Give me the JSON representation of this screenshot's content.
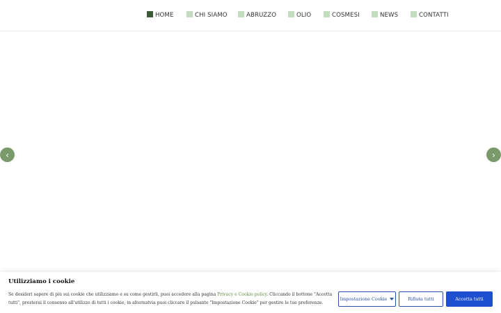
{
  "nav": {
    "items": [
      {
        "label": "HOME"
      },
      {
        "label": "CHI SIAMO"
      },
      {
        "label": "ABRUZZO"
      },
      {
        "label": "OLIO"
      },
      {
        "label": "COSMESI"
      },
      {
        "label": "NEWS"
      },
      {
        "label": "CONTATTI"
      }
    ],
    "active_item": "HOME"
  },
  "slider": {
    "prev_label": "‹",
    "next_label": "›"
  },
  "cookie": {
    "title": "Utilizziamo i cookie",
    "text_before_link": "Se desideri sapere di più sui cookie che utilizziamo e su come gestirli, puoi accedere alla pagina ",
    "link_text": "Privacy e Cookie policy",
    "text_after_link": ". Cliccando il bottone \"Accetta tutti\", presterai il consenso all'utilizzo di tutti i cookie, in alternatvia puoi cliccare il pulsante \"Impostazione Cookie\" per gestire le tue preferenze.",
    "settings_button": "Impostazione Cookie",
    "reject_button": "Rifiuta tutti",
    "accept_button": "Accetta tutti"
  },
  "colors": {
    "nav_square": "#c3dcc0",
    "nav_square_active": "#3c5a35",
    "arrow_bg": "#7a9a6c",
    "link": "#5d8f3d",
    "button_blue": "#1f4fd1"
  }
}
